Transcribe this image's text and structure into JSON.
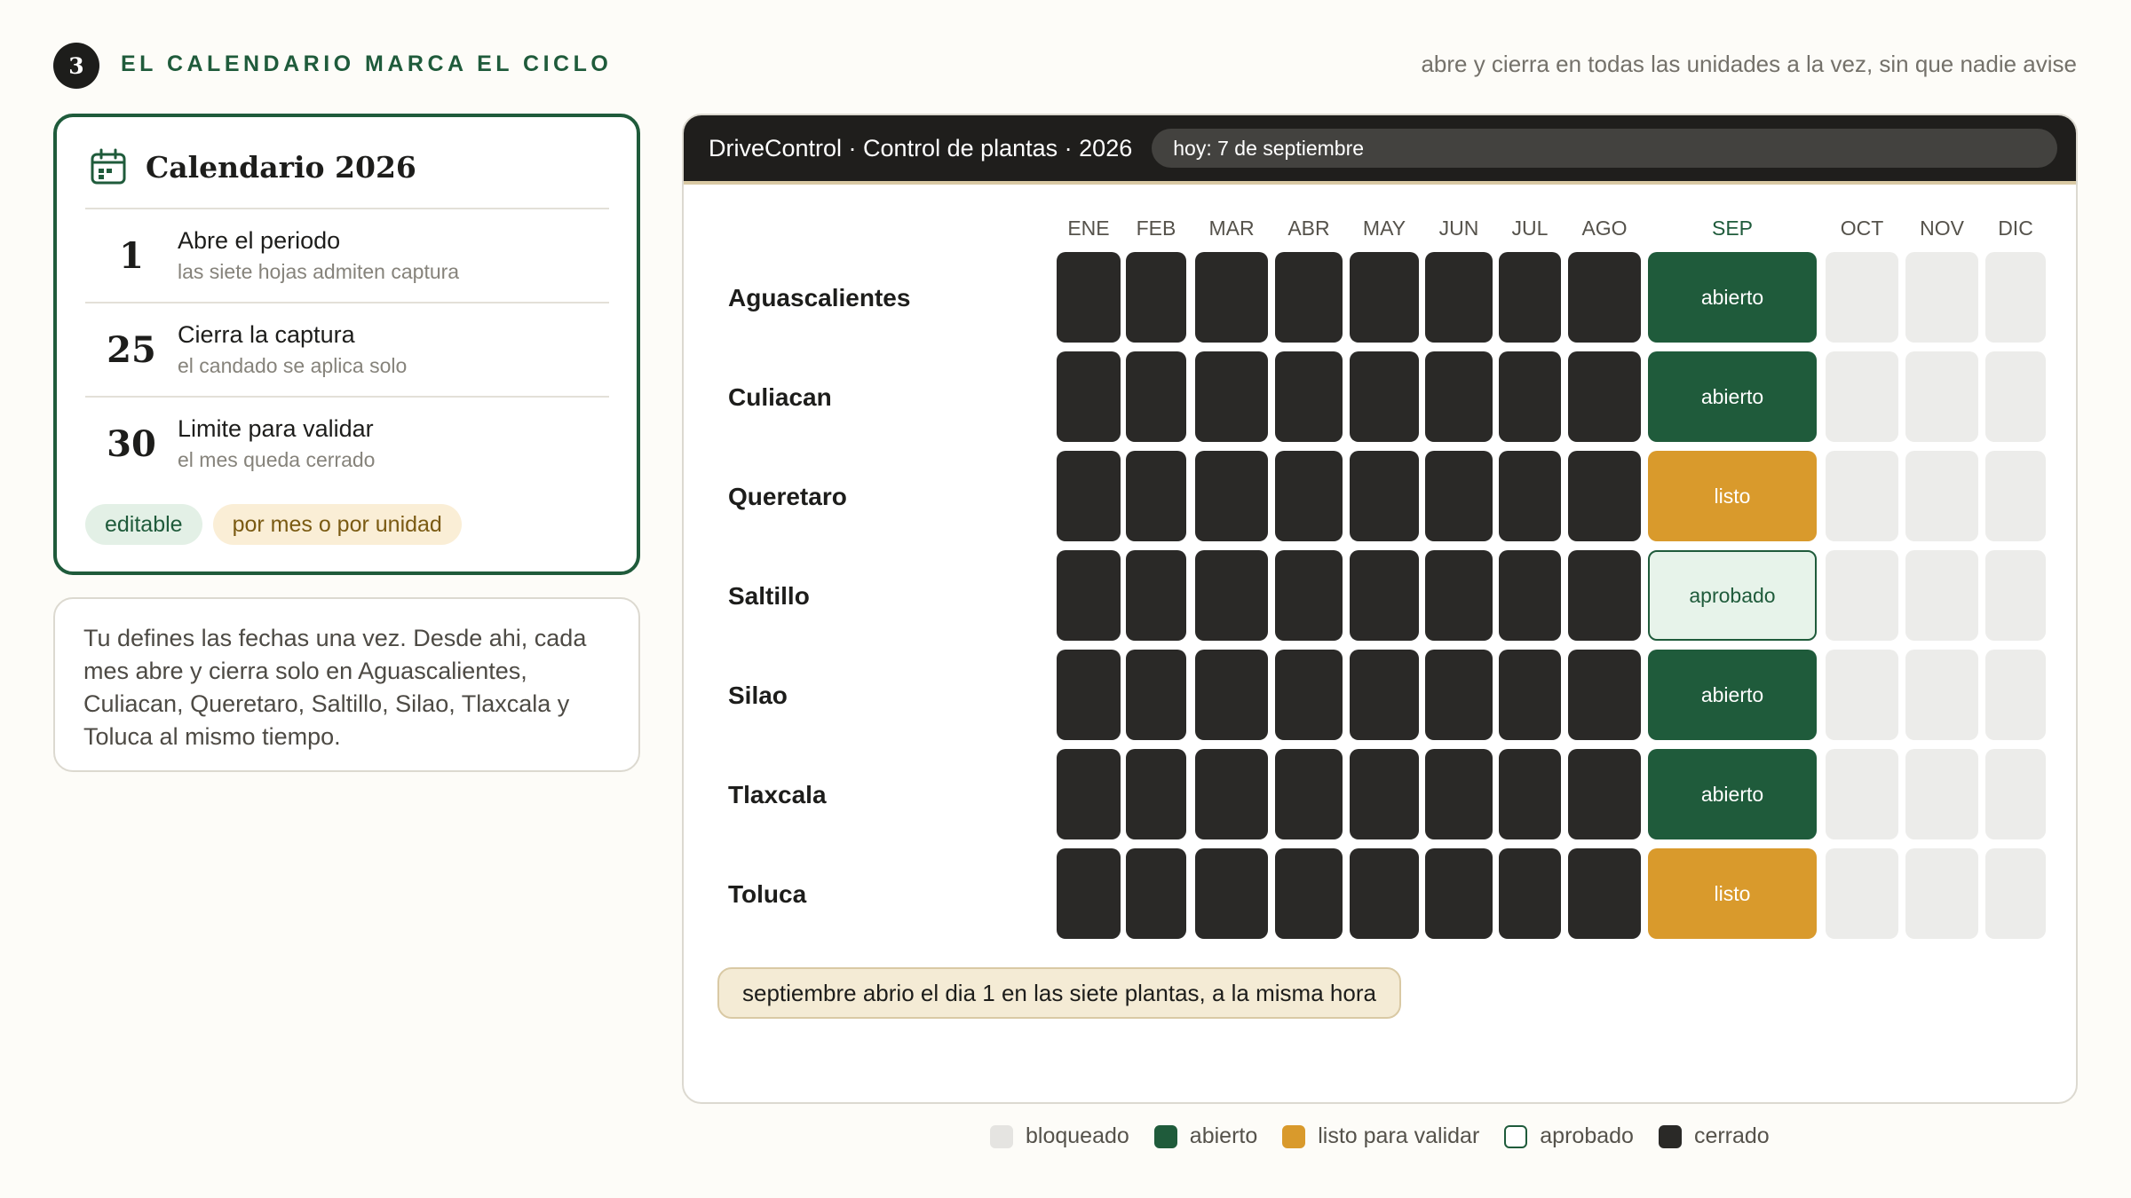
{
  "header": {
    "step_number": "3",
    "step_title": "EL CALENDARIO MARCA EL CICLO",
    "subtitle": "abre y cierra en todas las unidades a la vez, sin que nadie avise"
  },
  "calendar_card": {
    "icon": "calendar-icon",
    "title": "Calendario 2026",
    "items": [
      {
        "day": "1",
        "label": "Abre el periodo",
        "sub": "las siete hojas admiten captura"
      },
      {
        "day": "25",
        "label": "Cierra la captura",
        "sub": "el candado se aplica solo"
      },
      {
        "day": "30",
        "label": "Limite para validar",
        "sub": "el mes queda cerrado"
      }
    ],
    "chips": [
      "editable",
      "por mes o por unidad"
    ]
  },
  "note": "Tu defines las fechas una vez. Desde ahi, cada mes abre y cierra solo en Aguascalientes, Culiacan, Queretaro, Saltillo, Silao, Tlaxcala y Toluca al mismo tiempo.",
  "app": {
    "title": "DriveControl · Control de plantas · 2026",
    "today": "hoy: 7 de septiembre",
    "months": [
      "ENE",
      "FEB",
      "MAR",
      "ABR",
      "MAY",
      "JUN",
      "JUL",
      "AGO",
      "SEP",
      "OCT",
      "NOV",
      "DIC"
    ],
    "current_month_index": 8,
    "plants": [
      {
        "name": "Aguascalientes",
        "sep_state": "open",
        "sep_label": "abierto"
      },
      {
        "name": "Culiacan",
        "sep_state": "open",
        "sep_label": "abierto"
      },
      {
        "name": "Queretaro",
        "sep_state": "ready",
        "sep_label": "listo"
      },
      {
        "name": "Saltillo",
        "sep_state": "approved",
        "sep_label": "aprobado"
      },
      {
        "name": "Silao",
        "sep_state": "open",
        "sep_label": "abierto"
      },
      {
        "name": "Tlaxcala",
        "sep_state": "open",
        "sep_label": "abierto"
      },
      {
        "name": "Toluca",
        "sep_state": "ready",
        "sep_label": "listo"
      }
    ],
    "status_message": "septiembre abrio el dia 1 en las siete plantas, a la misma hora"
  },
  "legend": [
    {
      "state": "locked",
      "label": "bloqueado"
    },
    {
      "state": "open",
      "label": "abierto"
    },
    {
      "state": "ready",
      "label": "listo para validar"
    },
    {
      "state": "approved",
      "label": "aprobado"
    },
    {
      "state": "closed",
      "label": "cerrado"
    }
  ],
  "colors": {
    "green": "#1f5b3b",
    "amber": "#d99a2c",
    "dark": "#2a2927",
    "locked": "#ececea"
  }
}
